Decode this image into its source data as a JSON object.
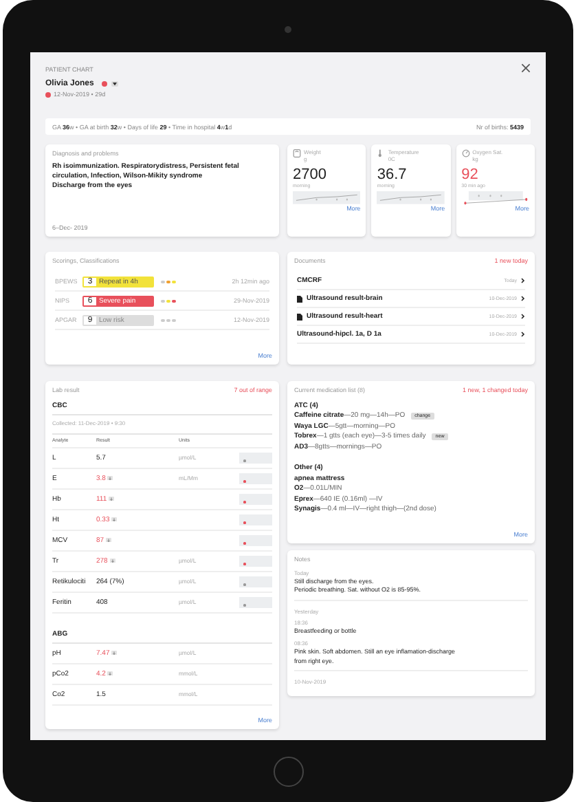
{
  "header": {
    "title": "PATIENT CHART",
    "name": "Olivia Jones",
    "birth": "12-Nov-2019 • 29d"
  },
  "info_bar": {
    "text": "GA **36**w • GA at birth **32**w • Days of life **29** • Time in hospital **4**w**1**d",
    "births_label": "Nr of births:",
    "births": "5439"
  },
  "diagnosis": {
    "title": "Diagnosis and problems",
    "lines": [
      "Rh isoimmunization. Respiratorydistress, Persistent fetal circulation, Infection, Wilson-Mikity syndrome",
      "Discharge from the eyes"
    ],
    "date": "6–Dec- 2019"
  },
  "vitals": [
    {
      "kind": "scale",
      "label": "Weight",
      "unit": "g",
      "value": "2700",
      "time": "morning",
      "alert": false,
      "more": "More"
    },
    {
      "kind": "thermometer",
      "label": "Temperature",
      "unit": "0C",
      "value": "36.7",
      "time": "morning",
      "alert": false,
      "more": "More"
    },
    {
      "kind": "gauge",
      "label": "Oxygen Sat.",
      "unit": "kg",
      "value": "92",
      "time": "30 min ago",
      "alert": true,
      "more": "More"
    }
  ],
  "scorings": {
    "title": "Scorings, Classifications",
    "items": [
      {
        "name": "BPEWS",
        "score": "3",
        "label": "Repeat in 4h",
        "color": "#f2e23a",
        "dots": [
          {
            "color": "#cccccc"
          },
          {
            "color": "#f0a030"
          },
          {
            "color": "#f2e23a"
          }
        ],
        "date": "2h 12min ago"
      },
      {
        "name": "NIPS",
        "score": "6",
        "label": "Severe pain",
        "color": "#e8505b",
        "dots": [
          {
            "color": "#cccccc"
          },
          {
            "color": "#f2e23a"
          },
          {
            "color": "#e8505b"
          }
        ],
        "date": "29-Nov-2019"
      },
      {
        "name": "APGAR",
        "score": "9",
        "label": "Low risk",
        "color": "#dddddd",
        "dots": [
          {
            "color": "#cccccc"
          },
          {
            "color": "#cccccc"
          },
          {
            "color": "#cccccc"
          }
        ],
        "date": "12-Nov-2019"
      }
    ],
    "more": "More"
  },
  "documents": {
    "title": "Documents",
    "badge": "1 new today",
    "items": [
      {
        "name": "CMCRF",
        "file_icon": false,
        "date": "Today"
      },
      {
        "name": "Ultrasound result-brain",
        "file_icon": true,
        "date": "10-Dec-2019"
      },
      {
        "name": "Ultrasound result-heart",
        "file_icon": true,
        "date": "10-Dec-2019"
      },
      {
        "name": "Ultrasound-hipcl. 1a, D 1a",
        "file_icon": false,
        "date": "10-Dec-2019"
      }
    ]
  },
  "lab": {
    "title": "Lab result",
    "badge": "7 out of range",
    "panels": [
      {
        "name": "CBC",
        "collected": "Collected: 11-Dec-2019 • 9:30",
        "columns": [
          "Analyte",
          "Result",
          "Units"
        ],
        "rows": [
          {
            "analyte": "L",
            "result": "5.7",
            "out_of_range": false,
            "units": "µmol/L",
            "trend": true
          },
          {
            "analyte": "E",
            "result": "3.8",
            "out_of_range": true,
            "units": "mL/Mm",
            "trend": true
          },
          {
            "analyte": "Hb",
            "result": "111",
            "out_of_range": true,
            "trend": true
          },
          {
            "analyte": "Ht",
            "result": "0.33",
            "out_of_range": true,
            "trend": true
          },
          {
            "analyte": "MCV",
            "result": "87",
            "out_of_range": true,
            "trend": true
          },
          {
            "analyte": "Tr",
            "result": "278",
            "out_of_range": true,
            "units": "µmol/L",
            "trend": true
          },
          {
            "analyte": "Retikulociti",
            "result": "264 (7%)",
            "out_of_range": false,
            "units": "µmol/L",
            "trend": true
          },
          {
            "analyte": "Feritin",
            "result": "408",
            "out_of_range": false,
            "units": "µmol/L",
            "trend": true
          }
        ]
      },
      {
        "name": "ABG",
        "rows": [
          {
            "analyte": "pH",
            "result": "7.47",
            "out_of_range": true,
            "units": "µmol/L",
            "trend": false
          },
          {
            "analyte": "pCo2",
            "result": "4.2",
            "out_of_range": true,
            "units": "mmol/L",
            "trend": false
          },
          {
            "analyte": "Co2",
            "result": "1.5",
            "out_of_range": false,
            "units": "mmol/L",
            "trend": false
          }
        ]
      }
    ],
    "more": "More"
  },
  "medications": {
    "title": "Current medication list (8)",
    "badge": "1 new, 1 changed today",
    "groups": [
      {
        "name": "ATC (4)",
        "items": [
          {
            "name": "Caffeine citrate",
            "detail": "—20 mg—14h—PO",
            "tag": "change"
          },
          {
            "name": "Waya LGC",
            "detail": "—5gtt—morning—PO"
          },
          {
            "name": "Tobrex",
            "detail": "—1 gtts (each eye)—3-5 times daily",
            "tag": "new"
          },
          {
            "name": "AD3",
            "detail": "—8gtts—mornings—PO"
          }
        ]
      },
      {
        "name": "Other (4)",
        "items": [
          {
            "name": "apnea mattress"
          },
          {
            "name": "O2",
            "detail": "—0.01L/MIN"
          },
          {
            "name": "Eprex",
            "detail": "—640 IE (0.16ml) —IV"
          },
          {
            "name": "Synagis",
            "detail": "—0.4 ml—IV—right thigh—(2nd dose)"
          }
        ]
      }
    ],
    "more": "More"
  },
  "notes": {
    "title": "Notes",
    "days": [
      {
        "day": "Today",
        "entries": [
          {
            "text": "Still discharge from the eyes.\nPeriodic breathing. Sat. without O2 is 85-95%."
          }
        ]
      },
      {
        "day": "Yesterday",
        "entries": [
          {
            "time": "18:36",
            "text": "Breastfeeding or bottle"
          },
          {
            "time": "08:36",
            "text": "Pink skin. Soft abdomen. Still an eye inflamation-discharge\nfrom right eye."
          }
        ]
      }
    ],
    "footer": "10-Nov-2019"
  }
}
